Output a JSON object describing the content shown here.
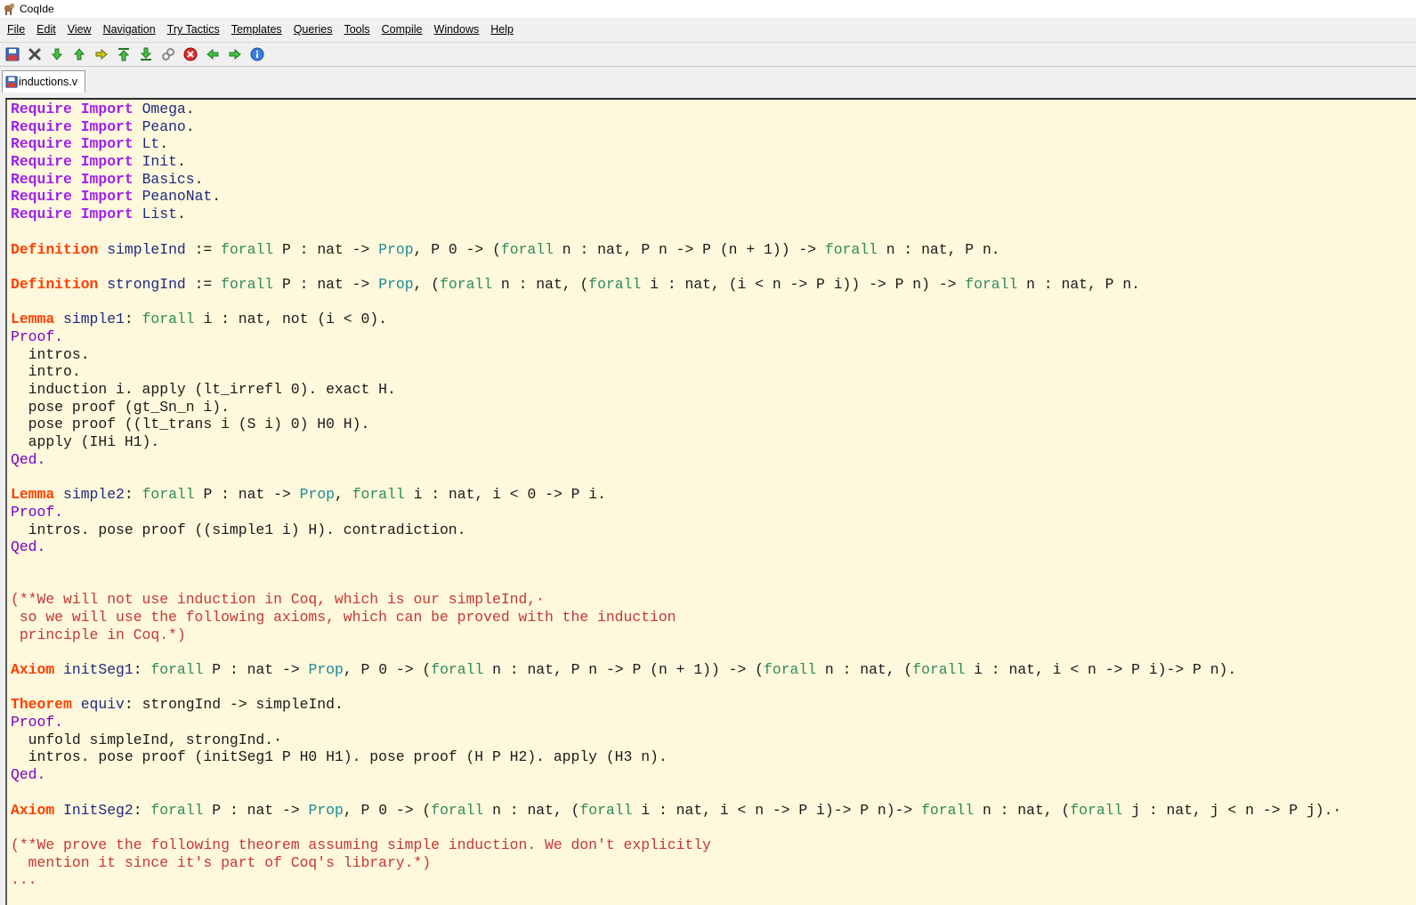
{
  "window": {
    "title": "CoqIde"
  },
  "menubar": {
    "items": [
      "File",
      "Edit",
      "View",
      "Navigation",
      "Try Tactics",
      "Templates",
      "Queries",
      "Tools",
      "Compile",
      "Windows",
      "Help"
    ]
  },
  "toolbar": {
    "buttons": [
      {
        "name": "save-icon",
        "color": "#2255aa"
      },
      {
        "name": "close-icon",
        "color": "#505050"
      },
      {
        "name": "forward-one-icon",
        "color": "#3cb043"
      },
      {
        "name": "backward-one-icon",
        "color": "#3cb043"
      },
      {
        "name": "go-to-cursor-icon",
        "color": "#b0b000"
      },
      {
        "name": "go-to-start-icon",
        "color": "#3cb043"
      },
      {
        "name": "go-to-end-icon",
        "color": "#3cb043"
      },
      {
        "name": "link-icon",
        "color": "#808080"
      },
      {
        "name": "interrupt-icon",
        "color": "#e02020"
      },
      {
        "name": "previous-occurrence-icon",
        "color": "#3cb043"
      },
      {
        "name": "next-occurrence-icon",
        "color": "#3cb043"
      },
      {
        "name": "about-icon",
        "color": "#2a6ed0"
      }
    ]
  },
  "tabs": [
    {
      "label": "inductions.v",
      "icon": "save-icon"
    }
  ],
  "colors": {
    "editor_bg": "#fef8dc",
    "vernacular": "#a020f0",
    "declaration": "#ff3f00",
    "forall": "#2e8b57",
    "prop": "#1c8a96",
    "identifier": "#1f2a80",
    "comment": "#c43838"
  },
  "code": [
    [
      [
        "kw-vernac",
        "Require"
      ],
      [
        "t",
        " "
      ],
      [
        "kw-vernac",
        "Import"
      ],
      [
        "t",
        " "
      ],
      [
        "tok-module",
        "Omega"
      ],
      [
        "t",
        "."
      ]
    ],
    [
      [
        "kw-vernac",
        "Require"
      ],
      [
        "t",
        " "
      ],
      [
        "kw-vernac",
        "Import"
      ],
      [
        "t",
        " "
      ],
      [
        "tok-module",
        "Peano"
      ],
      [
        "t",
        "."
      ]
    ],
    [
      [
        "kw-vernac",
        "Require"
      ],
      [
        "t",
        " "
      ],
      [
        "kw-vernac",
        "Import"
      ],
      [
        "t",
        " "
      ],
      [
        "tok-module",
        "Lt"
      ],
      [
        "t",
        "."
      ]
    ],
    [
      [
        "kw-vernac",
        "Require"
      ],
      [
        "t",
        " "
      ],
      [
        "kw-vernac",
        "Import"
      ],
      [
        "t",
        " "
      ],
      [
        "tok-module",
        "Init"
      ],
      [
        "t",
        "."
      ]
    ],
    [
      [
        "kw-vernac",
        "Require"
      ],
      [
        "t",
        " "
      ],
      [
        "kw-vernac",
        "Import"
      ],
      [
        "t",
        " "
      ],
      [
        "tok-module",
        "Basics"
      ],
      [
        "t",
        "."
      ]
    ],
    [
      [
        "kw-vernac",
        "Require"
      ],
      [
        "t",
        " "
      ],
      [
        "kw-vernac",
        "Import"
      ],
      [
        "t",
        " "
      ],
      [
        "tok-module",
        "PeanoNat"
      ],
      [
        "t",
        "."
      ]
    ],
    [
      [
        "kw-vernac",
        "Require"
      ],
      [
        "t",
        " "
      ],
      [
        "kw-vernac",
        "Import"
      ],
      [
        "t",
        " "
      ],
      [
        "tok-module",
        "List"
      ],
      [
        "t",
        "."
      ]
    ],
    [],
    [
      [
        "kw-decl",
        "Definition"
      ],
      [
        "t",
        " "
      ],
      [
        "tok-ident",
        "simpleInd"
      ],
      [
        "t",
        " := "
      ],
      [
        "tok-forall",
        "forall"
      ],
      [
        "t",
        " P : nat -> "
      ],
      [
        "tok-prop",
        "Prop"
      ],
      [
        "t",
        ", P 0 -> ("
      ],
      [
        "tok-forall",
        "forall"
      ],
      [
        "t",
        " n : nat, P n -> P (n + 1)) -> "
      ],
      [
        "tok-forall",
        "forall"
      ],
      [
        "t",
        " n : nat, P n."
      ]
    ],
    [],
    [
      [
        "kw-decl",
        "Definition"
      ],
      [
        "t",
        " "
      ],
      [
        "tok-ident",
        "strongInd"
      ],
      [
        "t",
        " := "
      ],
      [
        "tok-forall",
        "forall"
      ],
      [
        "t",
        " P : nat -> "
      ],
      [
        "tok-prop",
        "Prop"
      ],
      [
        "t",
        ", ("
      ],
      [
        "tok-forall",
        "forall"
      ],
      [
        "t",
        " n : nat, ("
      ],
      [
        "tok-forall",
        "forall"
      ],
      [
        "t",
        " i : nat, (i < n -> P i)) -> P n) -> "
      ],
      [
        "tok-forall",
        "forall"
      ],
      [
        "t",
        " n : nat, P n."
      ]
    ],
    [],
    [
      [
        "kw-decl",
        "Lemma"
      ],
      [
        "t",
        " "
      ],
      [
        "tok-ident",
        "simple1"
      ],
      [
        "t",
        ": "
      ],
      [
        "tok-forall",
        "forall"
      ],
      [
        "t",
        " i : nat, not (i < 0)."
      ]
    ],
    [
      [
        "tok-proof",
        "Proof."
      ]
    ],
    [
      [
        "t",
        "  intros."
      ]
    ],
    [
      [
        "t",
        "  intro."
      ]
    ],
    [
      [
        "t",
        "  induction i. apply (lt_irrefl 0). exact H."
      ]
    ],
    [
      [
        "t",
        "  pose proof (gt_Sn_n i)."
      ]
    ],
    [
      [
        "t",
        "  pose proof ((lt_trans i (S i) 0) H0 H)."
      ]
    ],
    [
      [
        "t",
        "  apply (IHi H1)."
      ]
    ],
    [
      [
        "tok-proof",
        "Qed."
      ]
    ],
    [],
    [
      [
        "kw-decl",
        "Lemma"
      ],
      [
        "t",
        " "
      ],
      [
        "tok-ident",
        "simple2"
      ],
      [
        "t",
        ": "
      ],
      [
        "tok-forall",
        "forall"
      ],
      [
        "t",
        " P : nat -> "
      ],
      [
        "tok-prop",
        "Prop"
      ],
      [
        "t",
        ", "
      ],
      [
        "tok-forall",
        "forall"
      ],
      [
        "t",
        " i : nat, i < 0 -> P i."
      ]
    ],
    [
      [
        "tok-proof",
        "Proof."
      ]
    ],
    [
      [
        "t",
        "  intros. pose proof ((simple1 i) H). contradiction."
      ]
    ],
    [
      [
        "tok-proof",
        "Qed."
      ]
    ],
    [],
    [],
    [
      [
        "tok-comment",
        "(**We will not use induction in Coq, which is our simpleInd,·"
      ]
    ],
    [
      [
        "tok-comment",
        " so we will use the following axioms, which can be proved with the induction"
      ]
    ],
    [
      [
        "tok-comment",
        " principle in Coq.*)"
      ]
    ],
    [],
    [
      [
        "kw-decl",
        "Axiom"
      ],
      [
        "t",
        " "
      ],
      [
        "tok-ident",
        "initSeg1"
      ],
      [
        "t",
        ": "
      ],
      [
        "tok-forall",
        "forall"
      ],
      [
        "t",
        " P : nat -> "
      ],
      [
        "tok-prop",
        "Prop"
      ],
      [
        "t",
        ", P 0 -> ("
      ],
      [
        "tok-forall",
        "forall"
      ],
      [
        "t",
        " n : nat, P n -> P (n + 1)) -> ("
      ],
      [
        "tok-forall",
        "forall"
      ],
      [
        "t",
        " n : nat, ("
      ],
      [
        "tok-forall",
        "forall"
      ],
      [
        "t",
        " i : nat, i < n -> P i)-> P n)."
      ]
    ],
    [],
    [
      [
        "kw-decl",
        "Theorem"
      ],
      [
        "t",
        " "
      ],
      [
        "tok-ident",
        "equiv"
      ],
      [
        "t",
        ": strongInd -> simpleInd."
      ]
    ],
    [
      [
        "tok-proof",
        "Proof."
      ]
    ],
    [
      [
        "t",
        "  unfold simpleInd, strongInd.·"
      ]
    ],
    [
      [
        "t",
        "  intros. pose proof (initSeg1 P H0 H1). pose proof (H P H2). apply (H3 n)."
      ]
    ],
    [
      [
        "tok-proof",
        "Qed."
      ]
    ],
    [],
    [
      [
        "kw-decl",
        "Axiom"
      ],
      [
        "t",
        " "
      ],
      [
        "tok-ident",
        "InitSeg2"
      ],
      [
        "t",
        ": "
      ],
      [
        "tok-forall",
        "forall"
      ],
      [
        "t",
        " P : nat -> "
      ],
      [
        "tok-prop",
        "Prop"
      ],
      [
        "t",
        ", P 0 -> ("
      ],
      [
        "tok-forall",
        "forall"
      ],
      [
        "t",
        " n : nat, ("
      ],
      [
        "tok-forall",
        "forall"
      ],
      [
        "t",
        " i : nat, i < n -> P i)-> P n)-> "
      ],
      [
        "tok-forall",
        "forall"
      ],
      [
        "t",
        " n : nat, ("
      ],
      [
        "tok-forall",
        "forall"
      ],
      [
        "t",
        " j : nat, j < n -> P j).·"
      ]
    ],
    [],
    [
      [
        "tok-comment",
        "(**We prove the following theorem assuming simple induction. We don't explicitly"
      ]
    ],
    [
      [
        "tok-comment",
        "  mention it since it's part of Coq's library.*)"
      ]
    ],
    [
      [
        "tok-comment",
        "..."
      ]
    ]
  ]
}
